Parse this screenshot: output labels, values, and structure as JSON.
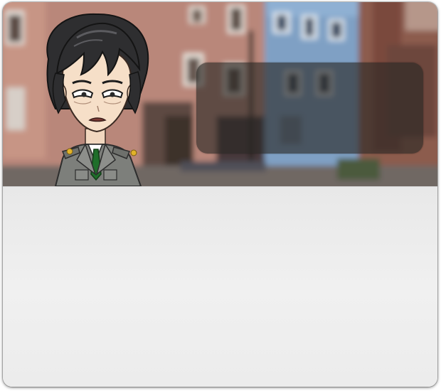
{
  "scene": {
    "background": "blurred-old-town-street",
    "character": "dark-haired-boy-in-grey-uniform"
  },
  "dialog": {
    "speaker": "",
    "text": ""
  },
  "panel": {
    "content": ""
  },
  "colors": {
    "dialog_bg": "#28262499",
    "panel_bg": "#eeeeee",
    "tie": "#1f6e2a",
    "uniform": "#7a7c78"
  }
}
